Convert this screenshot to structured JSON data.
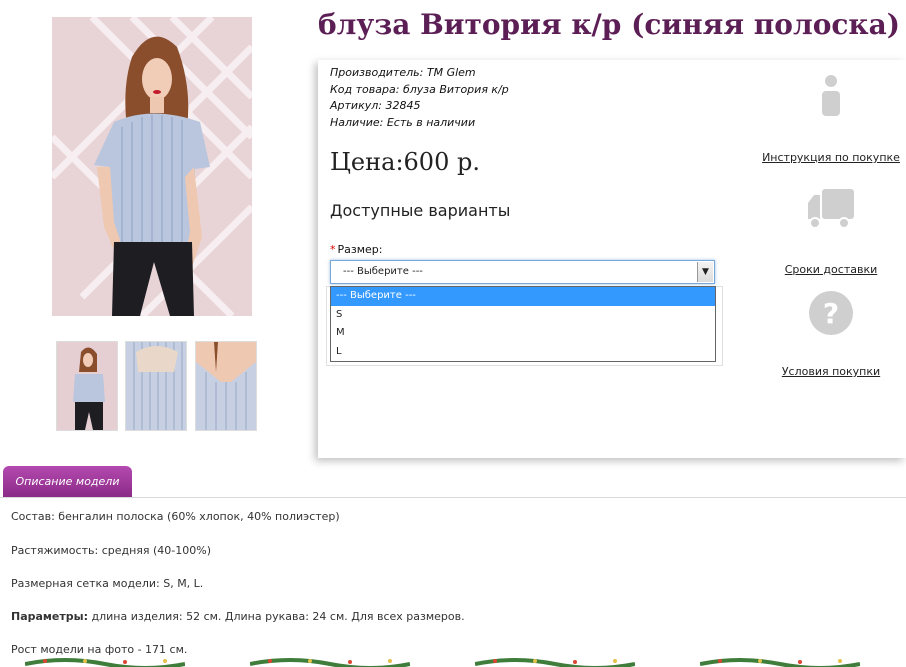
{
  "product": {
    "title": "блуза Витория к/р (синяя полоска)",
    "manufacturer_label": "Производитель:",
    "manufacturer_value": "TM Glem",
    "code_label": "Код товара:",
    "code_value": "блуза Витория к/р",
    "sku_label": "Артикул:",
    "sku_value": "32845",
    "stock_label": "Наличие:",
    "stock_value": "Есть в наличии",
    "price": "Цена:600 р.",
    "variants_heading": "Доступные варианты",
    "size_label": "Размер:",
    "required_mark": "*",
    "size_select": {
      "value": "--- Выберите ---",
      "options": [
        "--- Выберите ---",
        "S",
        "M",
        "L"
      ],
      "highlighted_index": 0
    }
  },
  "sidebar": {
    "instructions_link": "Инструкция по покупке",
    "delivery_link": "Сроки доставки",
    "terms_link": "Условия покупки"
  },
  "tabs": {
    "description_tab": "Описание модели"
  },
  "description": {
    "composition_label": "Состав:",
    "composition_value": "бенгалин полоска (60% хлопок, 40% полиэстер)",
    "stretch_label": "Растяжимость:",
    "stretch_value": "средняя (40-100%)",
    "sizes_label": "Размерная сетка модели:",
    "sizes_value": "S, M, L.",
    "params_label": "Параметры:",
    "params_value": "длина изделия: 52 см. Длина рукава: 24 см. Для всех размеров.",
    "model_height": "Рост модели на фото - 171 см."
  },
  "colors": {
    "title": "#5b1f55",
    "tab": "#a03c9c",
    "select_highlight": "#3399ff"
  },
  "icons": [
    "info-icon",
    "truck-icon",
    "question-icon",
    "dropdown-arrow-icon"
  ]
}
